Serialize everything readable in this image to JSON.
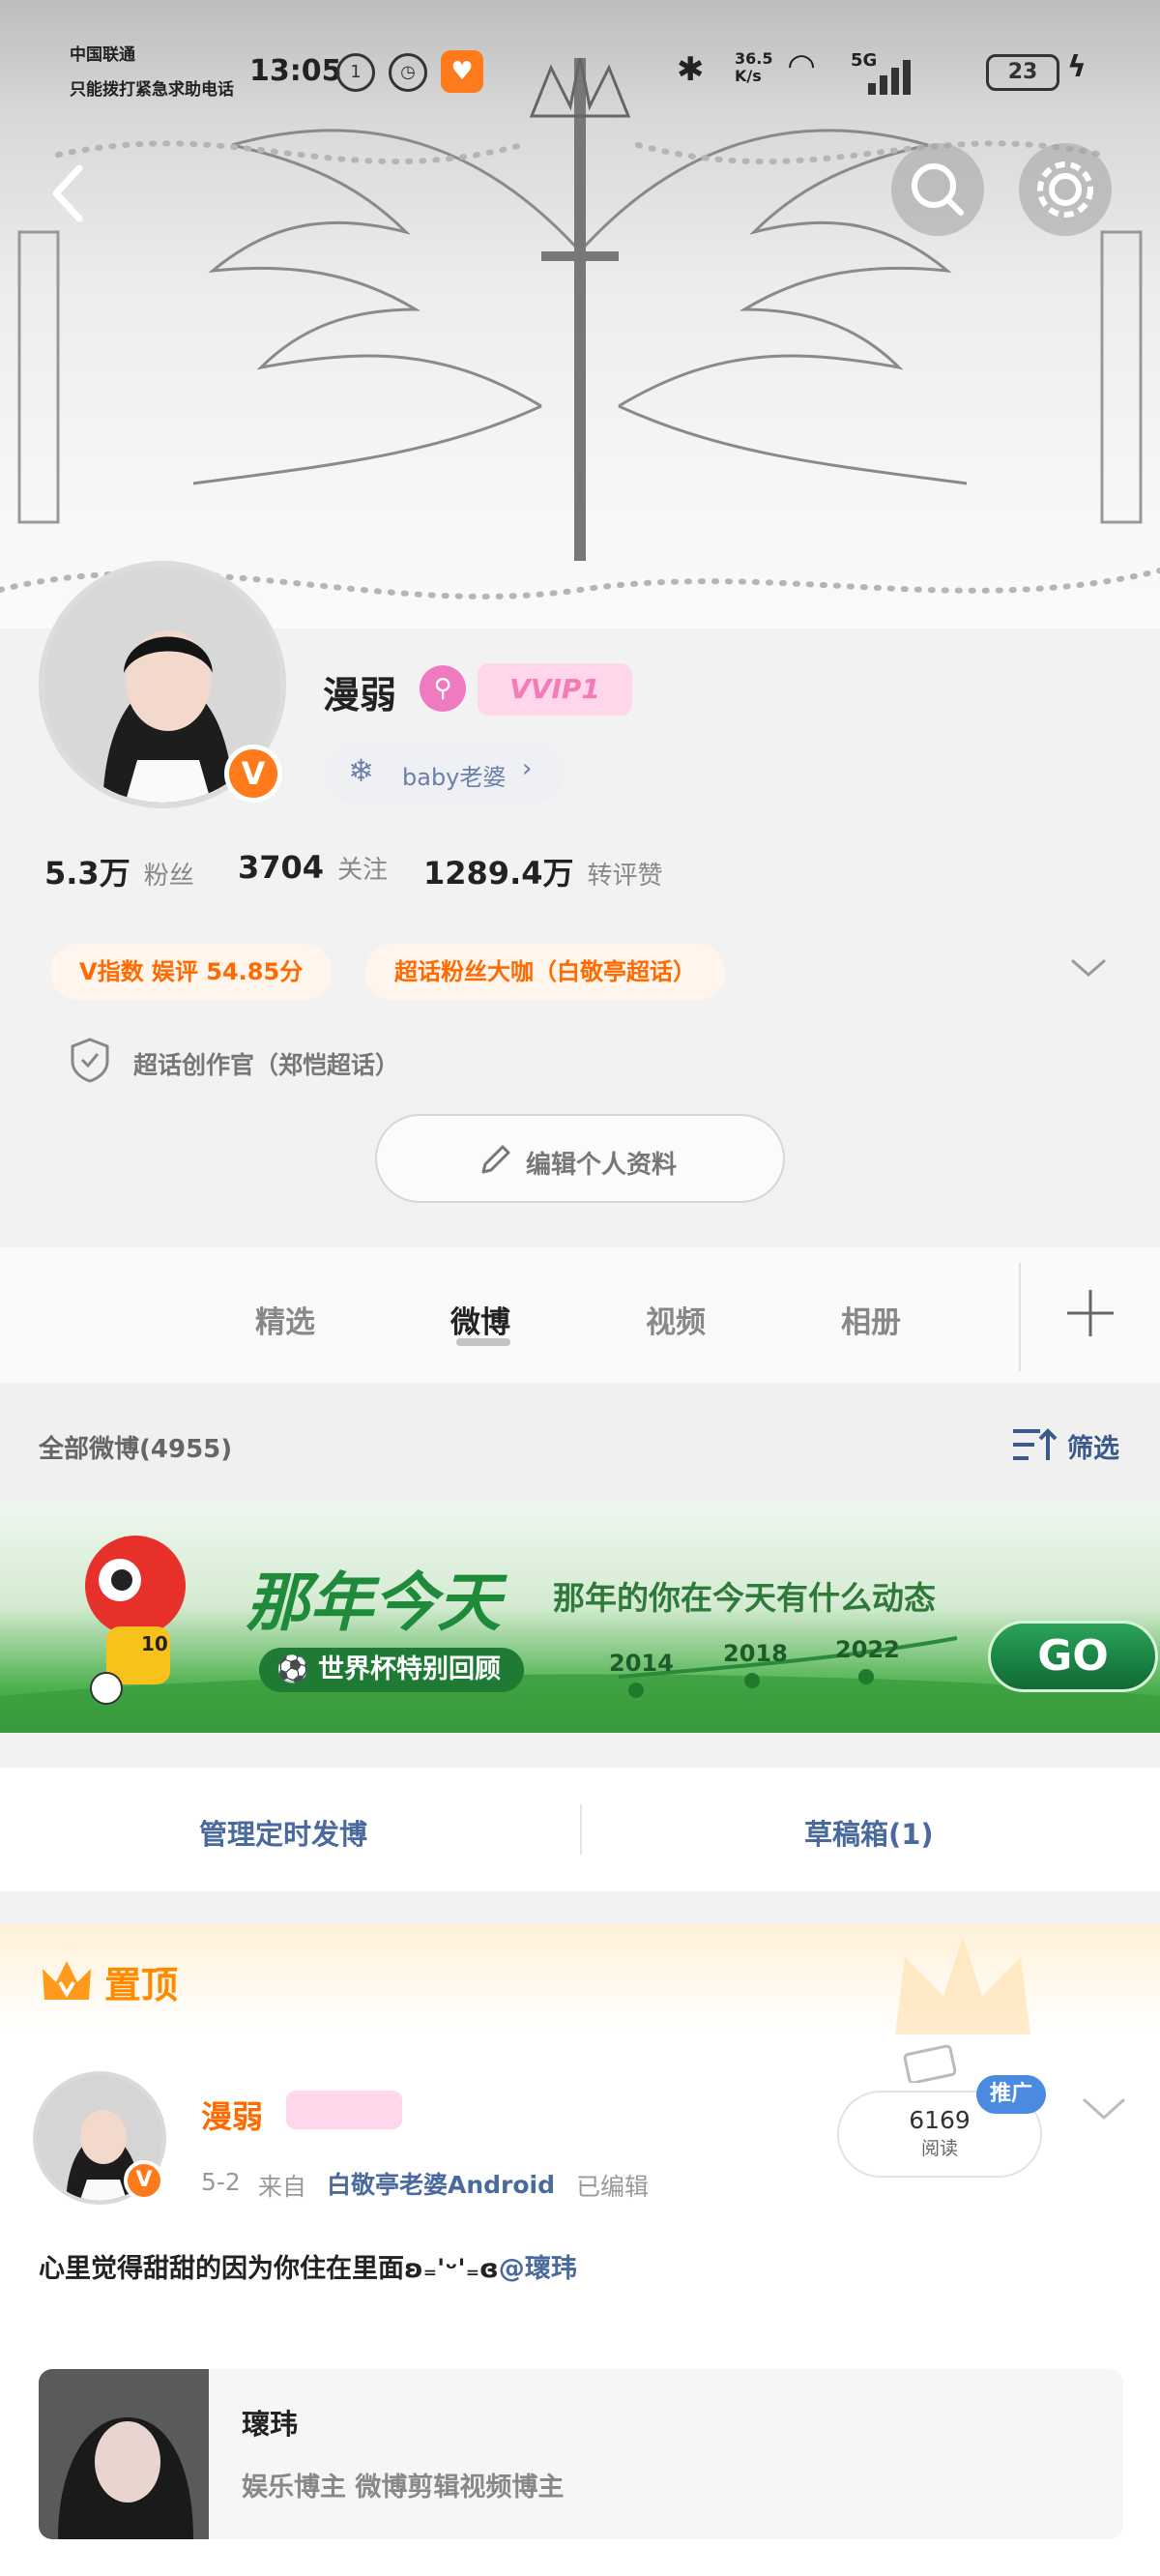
{
  "status_bar": {
    "carrier1": "中国联通",
    "carrier2": "只能拨打紧急求助电话",
    "time": "13:05",
    "net_speed_top": "36.5",
    "net_speed_unit": "K/s",
    "signal_label": "5G",
    "battery": "23"
  },
  "profile": {
    "name": "漫弱",
    "vip_badge": "VVIP1",
    "tag_label": "baby老婆",
    "verified_badge": "V"
  },
  "stats": [
    {
      "value": "5.3万",
      "label": "粉丝"
    },
    {
      "value": "3704",
      "label": "关注"
    },
    {
      "value": "1289.4万",
      "label": "转评赞"
    }
  ],
  "honors": {
    "v_index": "V指数 娱评 54.85分",
    "super_fan": "超话粉丝大咖（白敬亭超话）",
    "creator": "超话创作官（郑恺超话）"
  },
  "edit_profile_label": "编辑个人资料",
  "tabs": [
    {
      "label": "精选"
    },
    {
      "label": "微博",
      "active": true
    },
    {
      "label": "视频"
    },
    {
      "label": "相册"
    }
  ],
  "filter_bar": {
    "all_posts": "全部微博(4955)",
    "filter_label": "筛选"
  },
  "banner": {
    "title": "那年今天",
    "subtitle": "那年的你在今天有什么动态",
    "sub_badge": "世界杯特别回顾",
    "years": [
      "2014",
      "2018",
      "2022"
    ],
    "go_label": "GO",
    "jersey_number": "10"
  },
  "manage": {
    "scheduled": "管理定时发博",
    "drafts": "草稿箱(1)"
  },
  "pinned": {
    "label": "置顶"
  },
  "post": {
    "author": "漫弱",
    "date": "5-2",
    "from_prefix": "来自",
    "source": "白敬亭老婆Android",
    "edited": "已编辑",
    "reads_count": "6169",
    "reads_label": "阅读",
    "promote_label": "推广",
    "text": "心里觉得甜甜的因为你住在里面ʚ₌'ᵕ'₌ɞ",
    "mention": "@瓌玮",
    "card_title": "瓌玮",
    "card_subtitle": "娱乐博主 微博剪辑视频博主"
  },
  "colors": {
    "accent_orange": "#ff6a00",
    "link_blue": "#4a6a9e",
    "tab_active": "#222222",
    "banner_green": "#2fa84f"
  }
}
